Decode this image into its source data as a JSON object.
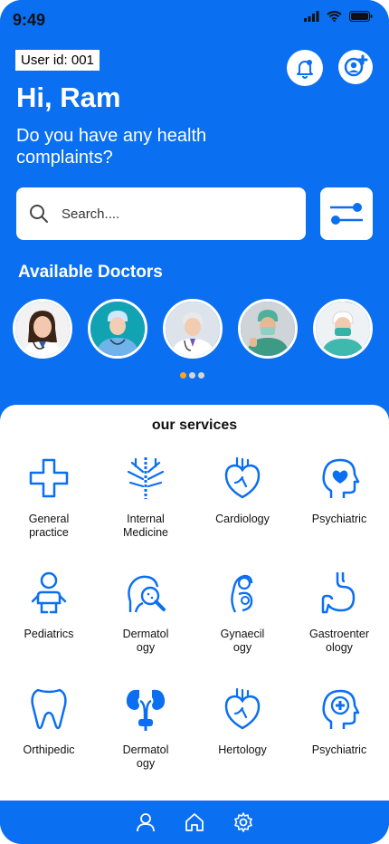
{
  "status": {
    "time": "9:49"
  },
  "header": {
    "user_id": "User id: 001",
    "greeting": "Hi, Ram",
    "question": "Do you have any health complaints?"
  },
  "search": {
    "placeholder": "Search...."
  },
  "doctors": {
    "title": "Available Doctors",
    "items": [
      {
        "icon": "doctor-1-avatar"
      },
      {
        "icon": "doctor-2-avatar"
      },
      {
        "icon": "doctor-3-avatar"
      },
      {
        "icon": "doctor-4-avatar"
      },
      {
        "icon": "doctor-5-avatar"
      }
    ],
    "pager": {
      "count": 3,
      "active": 0
    }
  },
  "services": {
    "title": "our services",
    "items": [
      {
        "label": "General\npractice",
        "icon": "medical-cross-icon"
      },
      {
        "label": "Internal\nMedicine",
        "icon": "bronchi-icon"
      },
      {
        "label": "Cardiology",
        "icon": "heart-icon"
      },
      {
        "label": "Psychiatric",
        "icon": "head-heart-icon"
      },
      {
        "label": "Pediatrics",
        "icon": "baby-icon"
      },
      {
        "label": "Dermatol\nogy",
        "icon": "face-magnifier-icon"
      },
      {
        "label": "Gynaecil\nogy",
        "icon": "pregnant-icon"
      },
      {
        "label": "Gastroenter\nology",
        "icon": "stomach-icon"
      },
      {
        "label": "Orthipedic",
        "icon": "tooth-icon"
      },
      {
        "label": "Dermatol\nogy",
        "icon": "kidneys-icon"
      },
      {
        "label": "Hertology",
        "icon": "heart-icon"
      },
      {
        "label": "Psychiatric",
        "icon": "head-medical-icon"
      }
    ]
  },
  "colors": {
    "primary": "#0B6FF2",
    "accent": "#F5A623",
    "surface": "#FFFFFF"
  }
}
